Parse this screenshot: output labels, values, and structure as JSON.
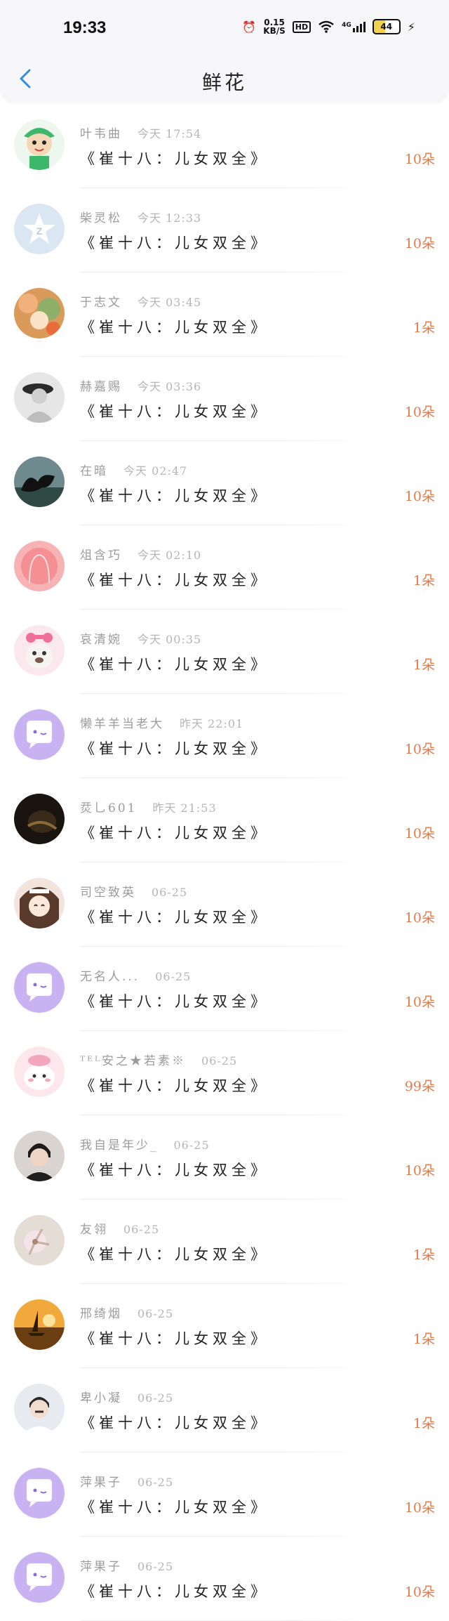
{
  "status": {
    "time": "19:33",
    "net_speed": "0.15",
    "net_unit": "KB/S",
    "hd": "HD",
    "signal": "4G",
    "battery": "44"
  },
  "header": {
    "title": "鲜花"
  },
  "items": [
    {
      "name": "叶韦曲",
      "time": "今天 17:54",
      "book": "《崔十八：儿女双全》",
      "count": "10朵"
    },
    {
      "name": "柴灵松",
      "time": "今天 12:33",
      "book": "《崔十八：儿女双全》",
      "count": "10朵"
    },
    {
      "name": "于志文",
      "time": "今天 03:45",
      "book": "《崔十八：儿女双全》",
      "count": "1朵"
    },
    {
      "name": "赫嘉赐",
      "time": "今天 03:36",
      "book": "《崔十八：儿女双全》",
      "count": "10朵"
    },
    {
      "name": "在暗",
      "time": "今天 02:47",
      "book": "《崔十八：儿女双全》",
      "count": "10朵"
    },
    {
      "name": "俎含巧",
      "time": "今天 02:10",
      "book": "《崔十八：儿女双全》",
      "count": "1朵"
    },
    {
      "name": "哀清婉",
      "time": "今天 00:35",
      "book": "《崔十八：儿女双全》",
      "count": "1朵"
    },
    {
      "name": "懒羊羊当老大",
      "time": "昨天 22:01",
      "book": "《崔十八：儿女双全》",
      "count": "10朵"
    },
    {
      "name": "烎乚601",
      "time": "昨天 21:53",
      "book": "《崔十八：儿女双全》",
      "count": "10朵"
    },
    {
      "name": "司空致英",
      "time": "06-25",
      "book": "《崔十八：儿女双全》",
      "count": "10朵"
    },
    {
      "name": "无名人...",
      "time": "06-25",
      "book": "《崔十八：儿女双全》",
      "count": "10朵"
    },
    {
      "name": "ᵀᴱᴸ安之★若素※",
      "time": "06-25",
      "book": "《崔十八：儿女双全》",
      "count": "99朵"
    },
    {
      "name": "我自是年少_",
      "time": "06-25",
      "book": "《崔十八：儿女双全》",
      "count": "10朵"
    },
    {
      "name": "友翎",
      "time": "06-25",
      "book": "《崔十八：儿女双全》",
      "count": "1朵"
    },
    {
      "name": "邢绮烟",
      "time": "06-25",
      "book": "《崔十八：儿女双全》",
      "count": "1朵"
    },
    {
      "name": "卑小凝",
      "time": "06-25",
      "book": "《崔十八：儿女双全》",
      "count": "1朵"
    },
    {
      "name": "萍果子",
      "time": "06-25",
      "book": "《崔十八：儿女双全》",
      "count": "10朵"
    },
    {
      "name": "萍果子",
      "time": "06-25",
      "book": "《崔十八：儿女双全》",
      "count": "10朵"
    }
  ],
  "colors": {
    "accent": "#2f8de4",
    "count": "#e07b4c",
    "avatar_default": "#c9b2f2"
  }
}
